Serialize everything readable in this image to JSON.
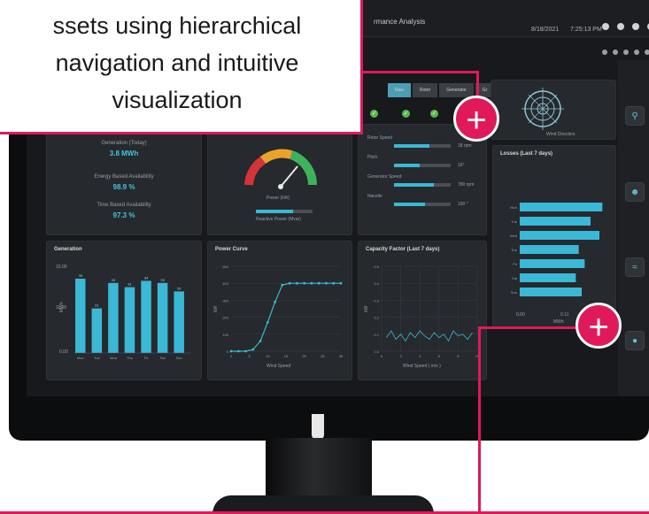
{
  "callout": {
    "text_line1": "ssets using hierarchical",
    "text_line2": "navigation and intuitive",
    "text_line3": "visualization"
  },
  "topbar": {
    "app_title": "rmance Analysis",
    "date": "8/18/2021",
    "time": "7:25:13 PM"
  },
  "tabs": [
    "Raw",
    "Rotor",
    "Generator",
    "Gr"
  ],
  "wind_direction_label": "Wind Direction",
  "kpis": [
    {
      "label": "Generation (Today)",
      "value": "3.8 MWh"
    },
    {
      "label": "Energy Based Availability",
      "value": "98.9 %"
    },
    {
      "label": "Time Based Availability",
      "value": "97.3 %"
    }
  ],
  "gauge": {
    "label": "Power (kW)",
    "reactive_label": "Reactive Power (Mvar)",
    "value_fraction": 0.72,
    "reactive_fraction": 0.65
  },
  "turbine_metrics": [
    {
      "label": "Rotor Speed",
      "unit": "18 rpm",
      "fraction": 0.62
    },
    {
      "label": "Pitch",
      "unit": "16°",
      "fraction": 0.45
    },
    {
      "label": "Generator Speed",
      "unit": "780 rpm",
      "fraction": 0.7
    },
    {
      "label": "Nacelle",
      "unit": "190 °",
      "fraction": 0.55
    }
  ],
  "losses_title": "Losses (Last 7 days)",
  "losses_axis": {
    "x0": "0.00",
    "x1": "0.11",
    "unit": "MWh"
  },
  "generation": {
    "title": "Generation",
    "ylabel": "MWh",
    "ytick_top": "10.00",
    "ytick_mid": "11.00",
    "ytick_bottom": "0.00"
  },
  "power_curve": {
    "title": "Power Curve",
    "ylabel": "kW",
    "xlabel": "Wind Speed"
  },
  "capacity": {
    "title": "Capacity Factor (Last 7 days)",
    "ylabel": "kW",
    "xlabel": "Wind Speed ( m/s )"
  },
  "chart_data": [
    {
      "type": "bar",
      "title": "Generation",
      "categories": [
        "Mon",
        "Tue",
        "Wed",
        "Thu",
        "Fri",
        "Sat",
        "Sun"
      ],
      "series": [
        {
          "values": [
            35,
            21,
            33,
            31,
            34,
            33,
            29
          ]
        }
      ],
      "value_labels": [
        "35",
        "21",
        "33",
        "31",
        "34",
        "33",
        "29"
      ],
      "extra_bar_values": [
        32,
        38
      ],
      "ylim": [
        0,
        40
      ]
    },
    {
      "type": "line",
      "title": "Power Curve",
      "xlabel": "Wind Speed",
      "ylabel": "kW",
      "x": [
        0,
        2,
        4,
        6,
        8,
        10,
        12,
        14,
        16,
        18,
        20,
        22,
        24,
        26,
        28,
        30
      ],
      "y": [
        0,
        0,
        0,
        10,
        60,
        170,
        290,
        390,
        400,
        400,
        400,
        400,
        400,
        400,
        400,
        400
      ],
      "xticks": [
        "0",
        "5",
        "10",
        "15",
        "20",
        "25",
        "30"
      ],
      "yticks": [
        "0",
        "100",
        "200",
        "300",
        "400",
        "500"
      ],
      "xlim": [
        0,
        30
      ],
      "ylim": [
        0,
        500
      ]
    },
    {
      "type": "line",
      "title": "Capacity Factor (Last 7 days)",
      "xlabel": "Wind Speed ( m/s )",
      "ylabel": "kW",
      "yticks": [
        "0.0",
        "0.1",
        "0.2",
        "0.3",
        "0.4",
        "0.5"
      ],
      "xticks": [
        "0",
        "2",
        "4",
        "6",
        "8",
        "10"
      ],
      "x": [
        0.5,
        1,
        1.5,
        2,
        2.5,
        3,
        3.5,
        4,
        4.5,
        5,
        5.5,
        6,
        6.5,
        7,
        7.5,
        8,
        8.5,
        9,
        9.5
      ],
      "y": [
        0.08,
        0.12,
        0.07,
        0.1,
        0.06,
        0.11,
        0.08,
        0.12,
        0.09,
        0.07,
        0.11,
        0.08,
        0.1,
        0.06,
        0.12,
        0.09,
        0.1,
        0.07,
        0.11
      ],
      "xlim": [
        0,
        10
      ],
      "ylim": [
        0,
        0.5
      ]
    },
    {
      "type": "bar",
      "title": "Losses (Last 7 days)",
      "orientation": "horizontal",
      "categories": [
        "Mon",
        "Tue",
        "Wed",
        "Thu",
        "Fri",
        "Sat",
        "Sun"
      ],
      "values": [
        0.14,
        0.12,
        0.135,
        0.1,
        0.11,
        0.095,
        0.105
      ],
      "xlim": [
        0,
        0.15
      ]
    }
  ],
  "colors": {
    "accent": "#3ab8d6",
    "callout": "#e0195a",
    "ok": "#58b947"
  }
}
